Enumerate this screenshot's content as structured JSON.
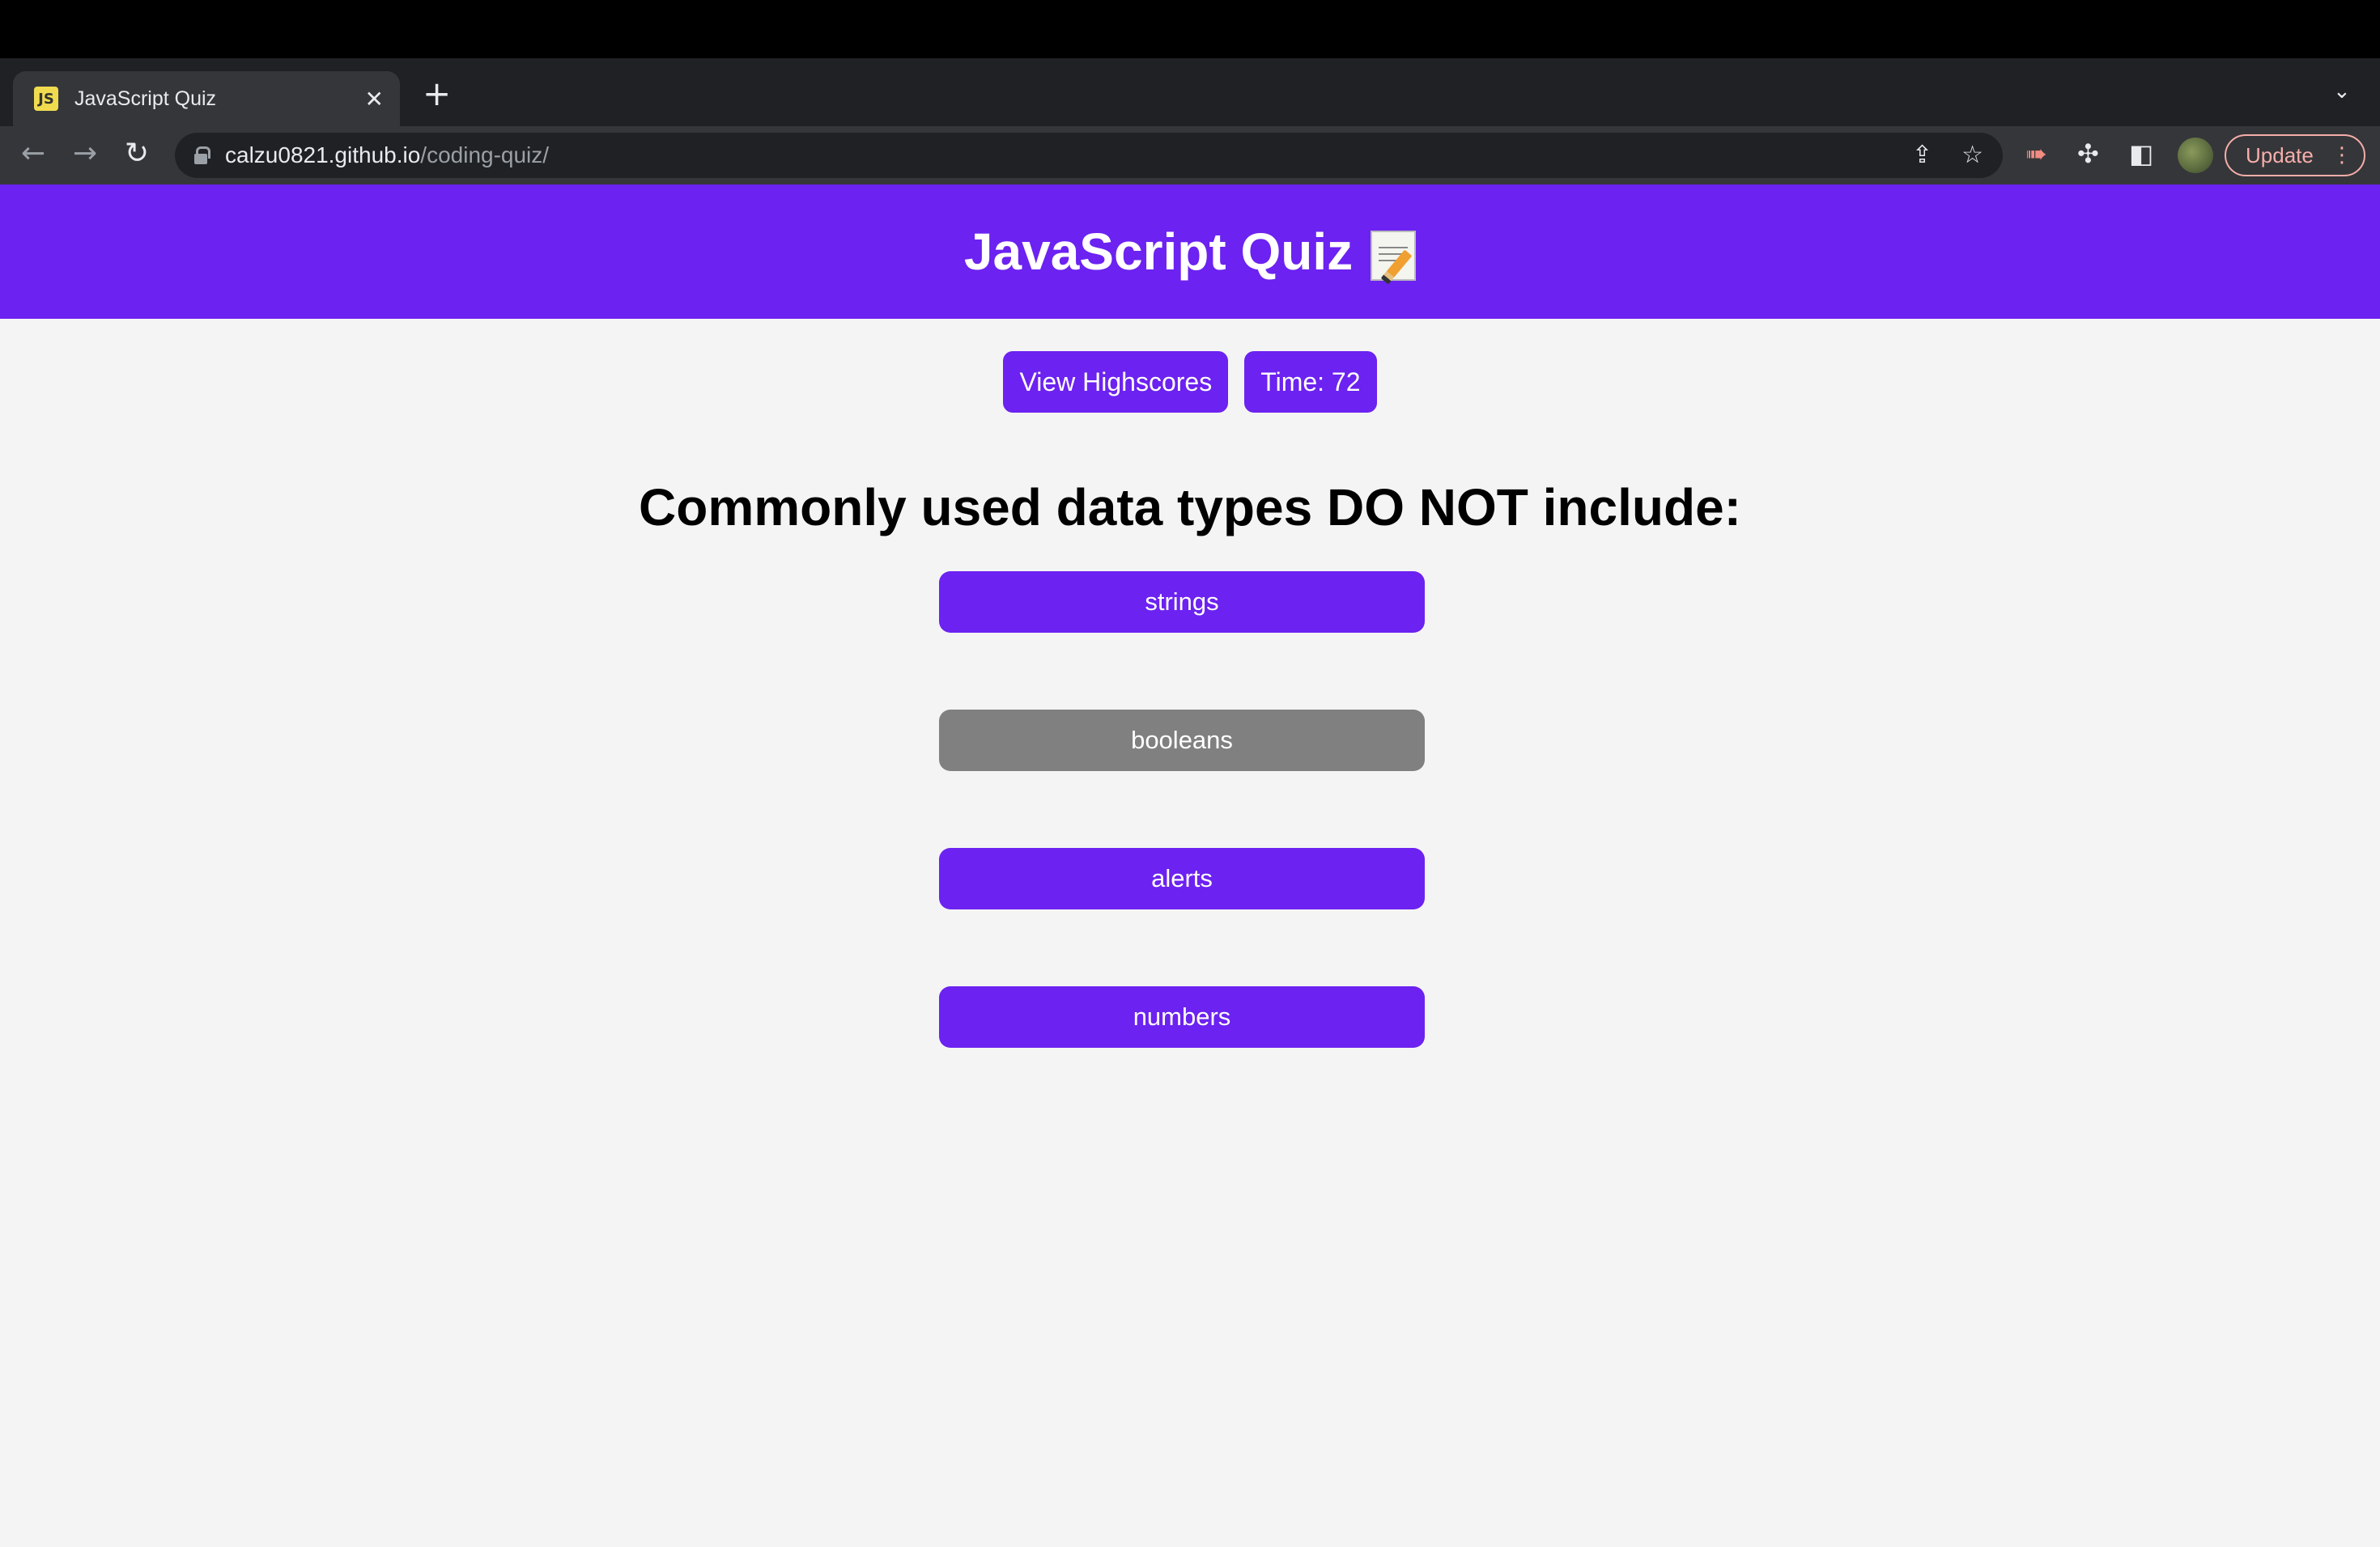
{
  "browser": {
    "tab_title": "JavaScript Quiz",
    "tab_favicon": "JS",
    "url_host": "calzu0821.github.io",
    "url_path": "/coding-quiz/",
    "update_label": "Update"
  },
  "header": {
    "title": "JavaScript Quiz",
    "icon": "memo-icon"
  },
  "controls": {
    "highscores_label": "View Highscores",
    "time_label": "Time: 72"
  },
  "question": {
    "text": "Commonly used data types DO NOT include:",
    "choices": [
      {
        "label": "strings",
        "selected": false
      },
      {
        "label": "booleans",
        "selected": true
      },
      {
        "label": "alerts",
        "selected": false
      },
      {
        "label": "numbers",
        "selected": false
      }
    ]
  },
  "colors": {
    "accent": "#6c22f0",
    "selected": "#808080",
    "background": "#f4f4f4"
  }
}
